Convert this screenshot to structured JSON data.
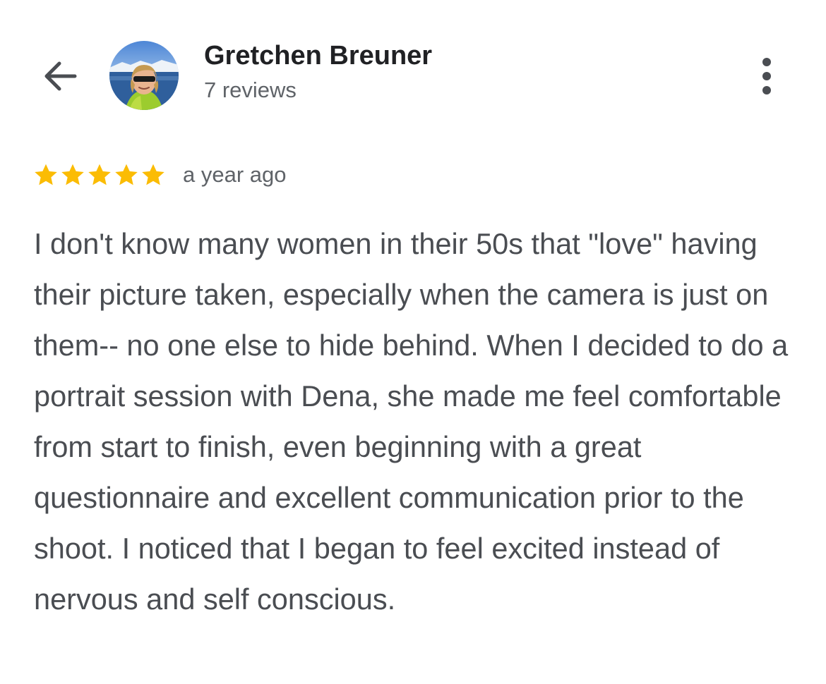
{
  "header": {
    "back_icon": "arrow-left-icon",
    "avatar_icon": "user-avatar-photo",
    "reviewer_name": "Gretchen Breuner",
    "review_count": "7 reviews",
    "more_icon": "more-vertical-icon"
  },
  "review": {
    "rating": 5,
    "rating_max": 5,
    "star_color": "#fbbc04",
    "date": "a year ago",
    "text": "I don't know many women in their 50s that \"love\" having their picture taken, especially when the camera is just on them-- no one else to hide behind. When I decided to do a portrait session with Dena, she made me feel comfortable from start to finish, even beginning with a great questionnaire and excellent communication prior to the shoot. I noticed that I began to feel excited instead of nervous and self conscious."
  }
}
